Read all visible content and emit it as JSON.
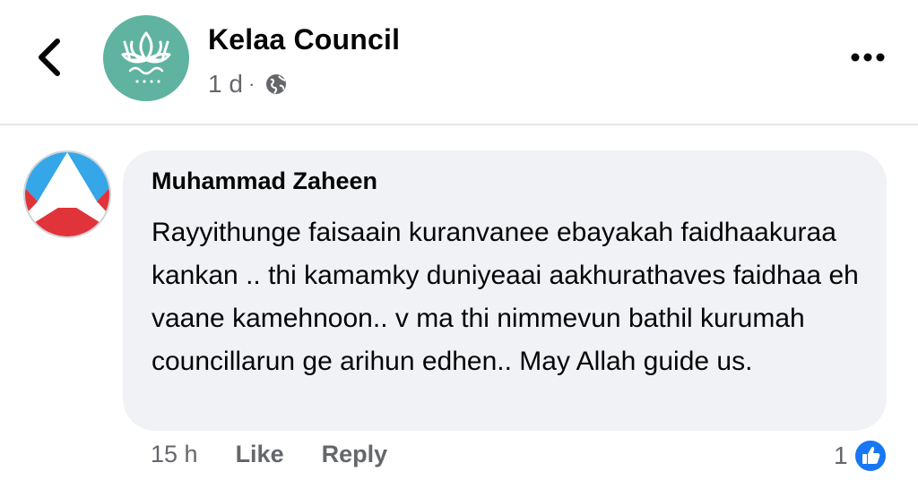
{
  "header": {
    "page_name": "Kelaa Council",
    "time_ago": "1 d",
    "separator": "·"
  },
  "comment": {
    "author": "Muhammad Zaheen",
    "text": "Rayyithunge faisaain kuranvanee ebayakah faidhaakuraa kankan .. thi kamamky duniyeaai aakhurathaves faidhaa eh vaane kamehnoon.. v ma thi nimmevun bathil kurumah councillarun ge arihun edhen.. May Allah guide us.",
    "time": "15 h",
    "like_label": "Like",
    "reply_label": "Reply",
    "reaction_count": "1"
  },
  "colors": {
    "page_avatar_bg": "#5fb3a0",
    "bubble_bg": "#f0f2f5",
    "meta_text": "#65676b",
    "like_blue": "#1877f2",
    "badge_red": "#e0343a",
    "badge_blue": "#35a6e8"
  },
  "icons": {
    "back": "chevron-left-icon",
    "more": "more-horizontal-icon",
    "audience": "globe-icon",
    "reaction": "like-icon"
  }
}
